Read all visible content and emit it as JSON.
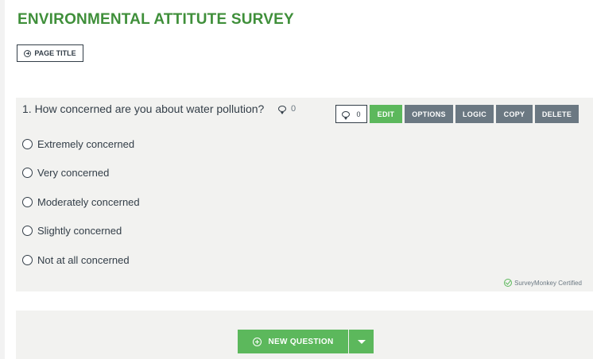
{
  "survey": {
    "title": "ENVIRONMENTAL ATTITUTE SURVEY"
  },
  "page_title_button": {
    "label": "PAGE TITLE",
    "icon": "plus-circle-icon"
  },
  "question": {
    "text": "1. How concerned are you about water pollution?",
    "comment_count": "0",
    "toolbar": {
      "comment_count": "0",
      "edit_label": "EDIT",
      "options_label": "OPTIONS",
      "logic_label": "LOGIC",
      "copy_label": "COPY",
      "delete_label": "DELETE"
    },
    "choices": [
      "Extremely concerned",
      "Very concerned",
      "Moderately concerned",
      "Slightly concerned",
      "Not at all concerned"
    ],
    "certified_label": "SurveyMonkey Certified"
  },
  "new_question": {
    "label": "NEW QUESTION"
  },
  "colors": {
    "brand_green": "#5cb85c",
    "title_green": "#3f8f3a",
    "button_gray": "#6b7882",
    "card_bg": "#f2f2f0"
  }
}
